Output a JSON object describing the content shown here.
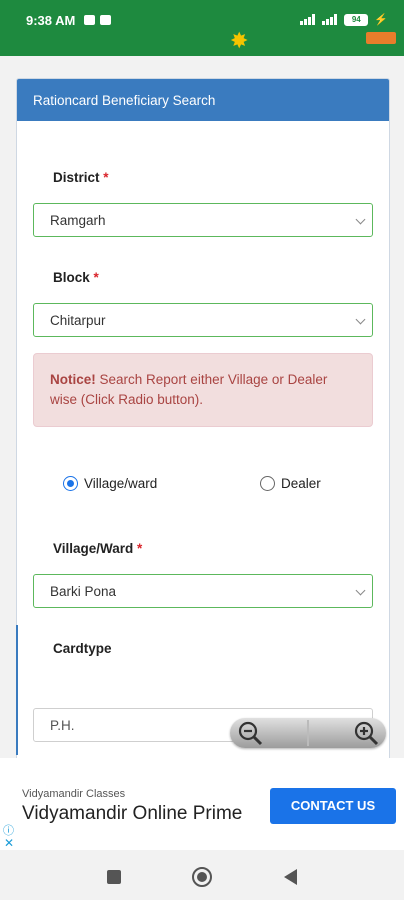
{
  "status_bar": {
    "time": "9:38 AM",
    "battery": "94"
  },
  "panel": {
    "title": "Rationcard Beneficiary Search"
  },
  "district": {
    "label": "District",
    "required_mark": "*",
    "value": "Ramgarh"
  },
  "block": {
    "label": "Block",
    "required_mark": "*",
    "value": "Chitarpur"
  },
  "notice": {
    "heading": "Notice!",
    "text": " Search Report either Village or Dealer wise (Click Radio button)."
  },
  "search_mode": {
    "options": [
      {
        "label": "Village/ward",
        "selected": true
      },
      {
        "label": "Dealer",
        "selected": false
      }
    ]
  },
  "village": {
    "label": "Village/Ward",
    "required_mark": "*",
    "value": "Barki Pona"
  },
  "cardtype": {
    "label": "Cardtype",
    "value": "P.H."
  },
  "ad": {
    "advertiser": "Vidyamandir Classes",
    "headline": "Vidyamandir Online Prime",
    "cta": "CONTACT US",
    "info_glyph": "ⓘ",
    "close_glyph": "✕"
  },
  "colors": {
    "status_bar": "#1e8a3f",
    "panel_header": "#3a7bbf",
    "valid_border": "#5cb85c",
    "notice_bg": "#f2dede",
    "notice_text": "#a94442",
    "cta_bg": "#1a73e8"
  }
}
